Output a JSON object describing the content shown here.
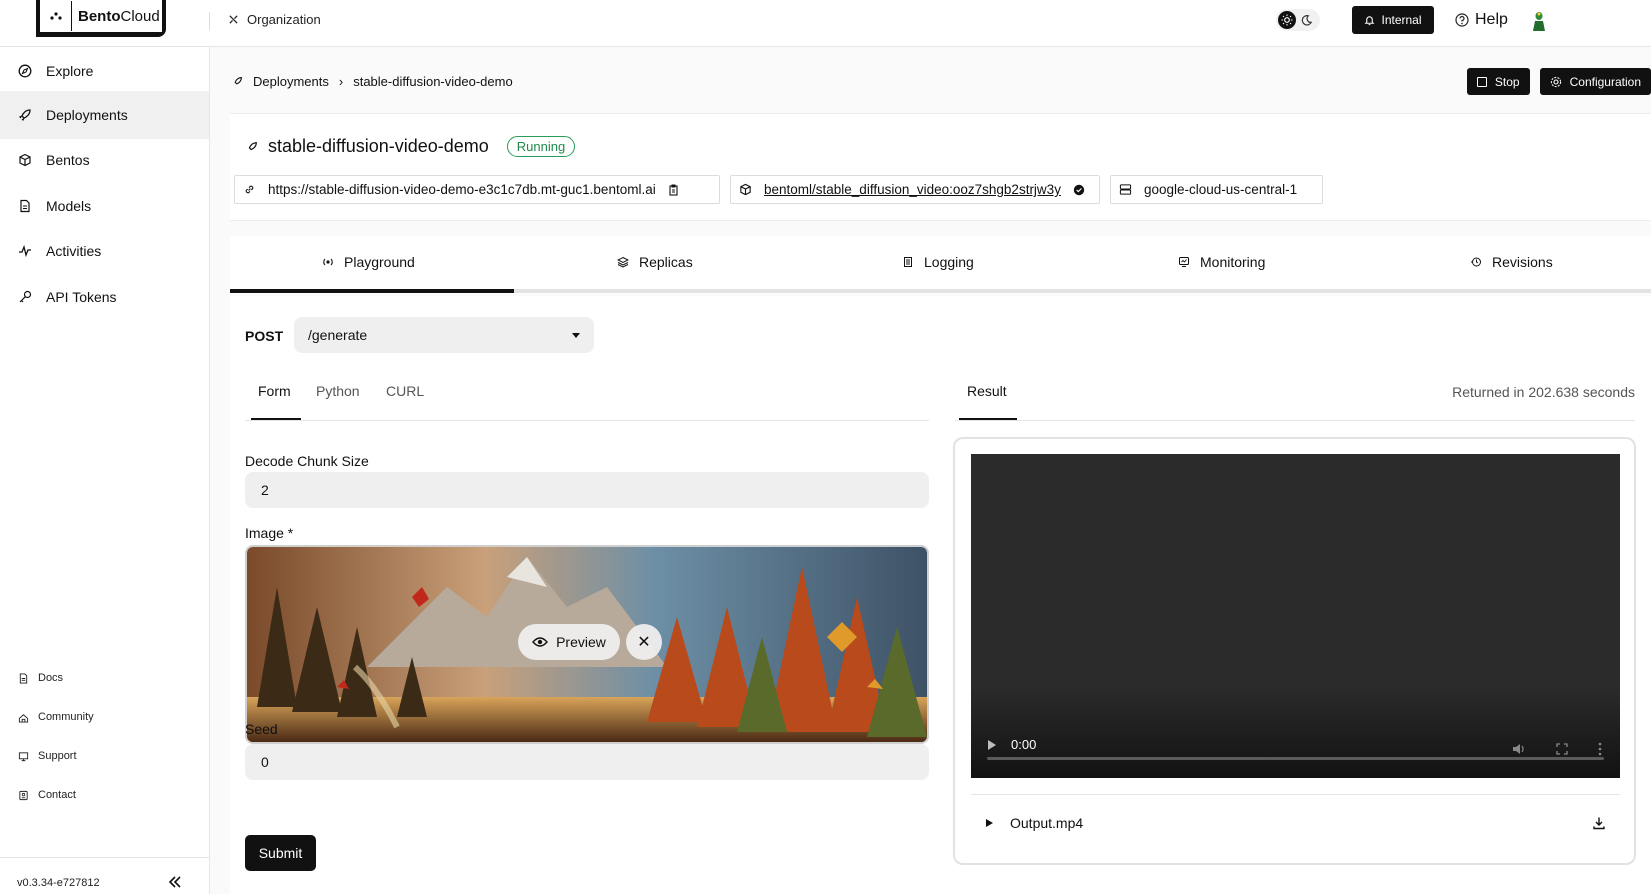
{
  "header": {
    "logo_bold": "Bento",
    "logo_light": "Cloud",
    "org_label": "Organization",
    "internal_label": "Internal",
    "help_label": "Help"
  },
  "sidebar": {
    "items": [
      {
        "label": "Explore"
      },
      {
        "label": "Deployments"
      },
      {
        "label": "Bentos"
      },
      {
        "label": "Models"
      },
      {
        "label": "Activities"
      },
      {
        "label": "API Tokens"
      }
    ],
    "footer": [
      {
        "label": "Docs"
      },
      {
        "label": "Community"
      },
      {
        "label": "Support"
      },
      {
        "label": "Contact"
      }
    ],
    "version": "v0.3.34-e727812"
  },
  "breadcrumb": {
    "root": "Deployments",
    "current": "stable-diffusion-video-demo"
  },
  "actions": {
    "stop_label": "Stop",
    "config_label": "Configuration"
  },
  "deployment": {
    "name": "stable-diffusion-video-demo",
    "status": "Running",
    "url": "https://stable-diffusion-video-demo-e3c1c7db.mt-guc1.bentoml.ai",
    "bento": "bentoml/stable_diffusion_video:ooz7shgb2strjw3y",
    "cluster": "google-cloud-us-central-1"
  },
  "tabs": [
    {
      "label": "Playground"
    },
    {
      "label": "Replicas"
    },
    {
      "label": "Logging"
    },
    {
      "label": "Monitoring"
    },
    {
      "label": "Revisions"
    }
  ],
  "playground": {
    "method": "POST",
    "endpoint": "/generate",
    "subtabs": [
      "Form",
      "Python",
      "CURL"
    ],
    "fields": {
      "decode_chunk_label": "Decode Chunk Size",
      "decode_chunk_value": "2",
      "image_label": "Image *",
      "preview_label": "Preview",
      "seed_label": "Seed",
      "seed_value": "0"
    },
    "submit_label": "Submit",
    "result_tab": "Result",
    "returned_text": "Returned in 202.638 seconds",
    "video_time": "0:00",
    "output_file": "Output.mp4"
  },
  "colors": {
    "accent": "#111111",
    "running": "#2a9d5a"
  }
}
